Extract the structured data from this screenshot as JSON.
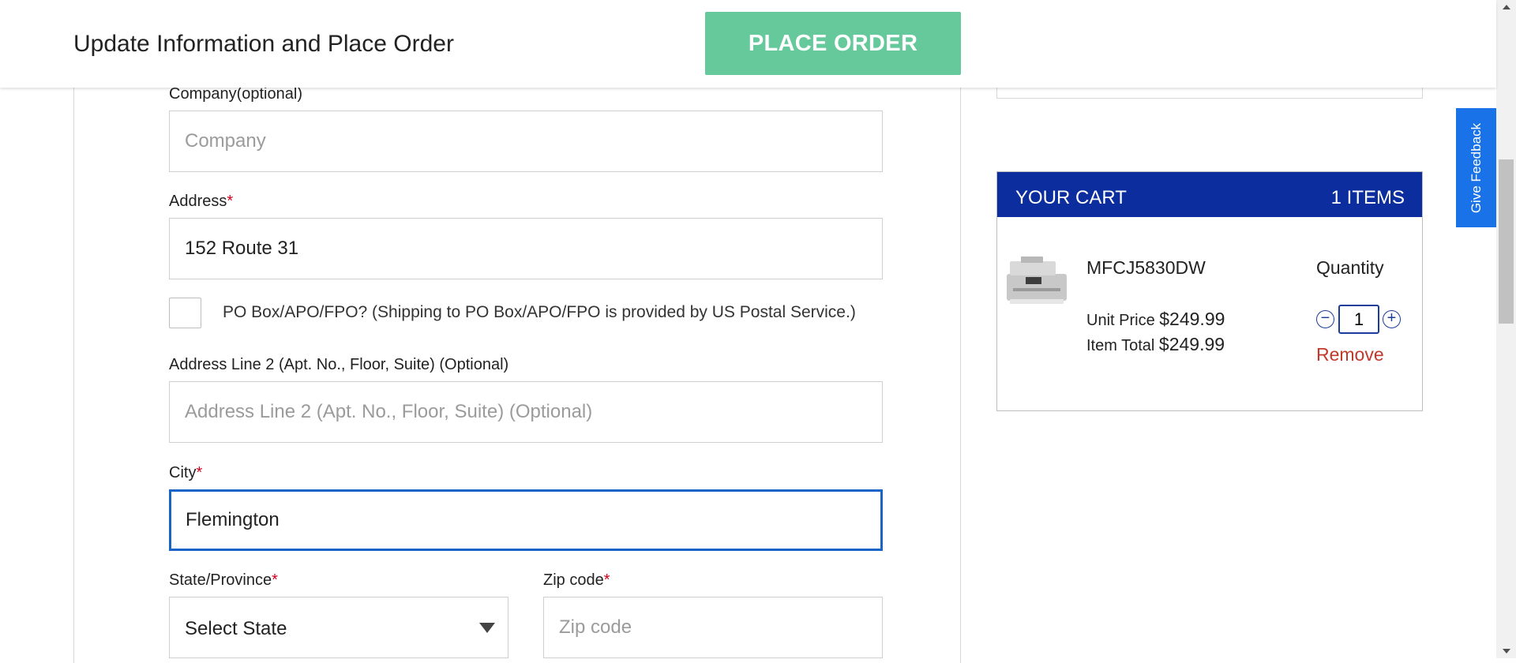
{
  "header": {
    "title": "Update Information and Place Order",
    "place_order_label": "PLACE ORDER"
  },
  "form": {
    "company": {
      "label": "Company(optional)",
      "placeholder": "Company",
      "value": ""
    },
    "address": {
      "label": "Address",
      "required_mark": "*",
      "value": "152 Route 31"
    },
    "po_box": {
      "label": "PO Box/APO/FPO? (Shipping to PO Box/APO/FPO is provided by US Postal Service.)",
      "checked": false
    },
    "address2": {
      "label": "Address Line 2 (Apt. No., Floor, Suite) (Optional)",
      "placeholder": "Address Line 2 (Apt. No., Floor, Suite) (Optional)",
      "value": ""
    },
    "city": {
      "label": "City",
      "required_mark": "*",
      "value": "Flemington"
    },
    "state": {
      "label": "State/Province",
      "required_mark": "*",
      "selected": "Select State"
    },
    "zip": {
      "label": "Zip code",
      "required_mark": "*",
      "placeholder": "Zip code",
      "value": ""
    }
  },
  "cart": {
    "title": "YOUR CART",
    "count": "1 ITEMS",
    "item": {
      "name": "MFCJ5830DW",
      "quantity_label": "Quantity",
      "quantity": "1",
      "unit_price_label": "Unit Price",
      "unit_price": "$249.99",
      "item_total_label": "Item Total",
      "item_total": "$249.99",
      "remove_label": "Remove"
    },
    "header_color": "#0b2d9d"
  },
  "feedback": {
    "label": "Give Feedback"
  },
  "colors": {
    "accent_green": "#66c99c",
    "focus_blue": "#1a63c7",
    "required_red": "#d0021b",
    "remove_red": "#c0392b",
    "feedback_blue": "#1a72e8"
  }
}
